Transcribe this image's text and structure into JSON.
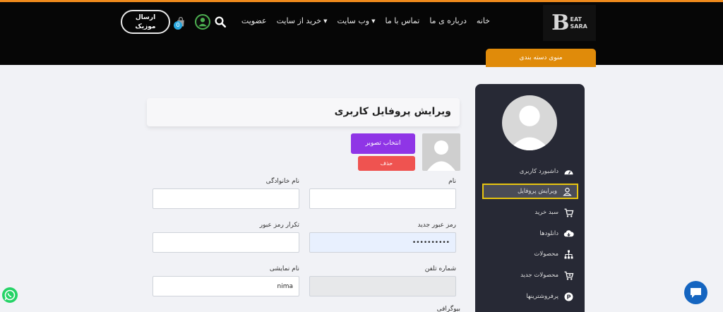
{
  "header": {
    "logo": {
      "letter": "B",
      "line1": "EAT",
      "line2": "SARA"
    },
    "nav": [
      {
        "label": "خانه",
        "dropdown": false
      },
      {
        "label": "درباره ی ما",
        "dropdown": false
      },
      {
        "label": "تماس با ما",
        "dropdown": false
      },
      {
        "label": "وب سایت",
        "dropdown": true
      },
      {
        "label": "خرید از سایت",
        "dropdown": true
      },
      {
        "label": "عضویت",
        "dropdown": false
      }
    ],
    "cart_count": "0",
    "send_music_line1": "ارسال",
    "send_music_line2": "موزیک",
    "category_menu": "منوی دسته بندی",
    "caret": "▼"
  },
  "sidebar": {
    "items": [
      {
        "label": "داشبورد کاربری",
        "icon": "dashboard-icon"
      },
      {
        "label": "ویرایش پروفایل",
        "icon": "user-icon"
      },
      {
        "label": "سبد خرید",
        "icon": "cart-icon"
      },
      {
        "label": "دانلودها",
        "icon": "cloud-download-icon"
      },
      {
        "label": "محصولات",
        "icon": "sitemap-icon"
      },
      {
        "label": "محصولات جدید",
        "icon": "cart-plus-icon"
      },
      {
        "label": "پرفروشترینها",
        "icon": "p-circle-icon"
      }
    ],
    "active_index": 1
  },
  "main": {
    "title": "ویرایش پروفایل کاربری",
    "choose_image": "انتخاب تصویر",
    "delete": "حذف",
    "fields": {
      "first_name": {
        "label": "نام",
        "value": ""
      },
      "last_name": {
        "label": "نام خانوادگی",
        "value": ""
      },
      "new_password": {
        "label": "رمز عبور جدید",
        "value": "••••••••••"
      },
      "repeat_password": {
        "label": "تکرار رمز عبور",
        "value": ""
      },
      "phone": {
        "label": "شماره تلفن",
        "value": ""
      },
      "display_name": {
        "label": "نام نمایشی",
        "value": "nima"
      },
      "bio": {
        "label": "بیوگرافی"
      }
    }
  },
  "colors": {
    "accent": "#ee8a1c",
    "choose_button": "#8f35e6",
    "delete_button": "#ef5350",
    "active_border": "#e8c50f"
  }
}
